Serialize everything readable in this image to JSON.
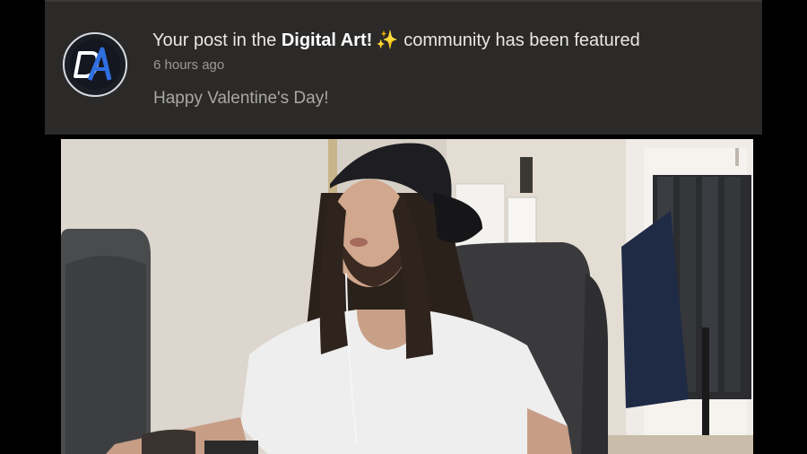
{
  "notification": {
    "title_prefix": "Your post in the ",
    "community_name": "Digital Art!",
    "sparkle_icon": "sparkles-icon",
    "title_suffix": "community has been featured",
    "timestamp": "6 hours ago",
    "message": "Happy Valentine's Day!",
    "avatar_icon": "digital-art-community-logo"
  },
  "video": {
    "content": "webcam-video-frame"
  },
  "colors": {
    "panel_background": "#2b2a29",
    "title_text": "#e9e8e6",
    "muted_text": "#9b9a97",
    "logo_accent": "#2f6fe0"
  }
}
